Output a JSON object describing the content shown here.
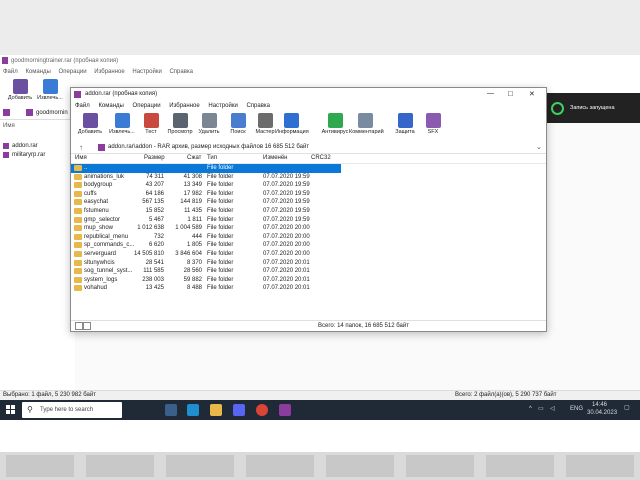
{
  "background_window": {
    "title": "goodmorningtrainer.rar (пробная копия)",
    "menu": [
      "Файл",
      "Команды",
      "Операции",
      "Избранное",
      "Настройки",
      "Справка"
    ],
    "tools": [
      "Добавить",
      "Извлечь..."
    ],
    "addr": "goodmornin",
    "list_header": "Имя",
    "files": [
      "addon.rar",
      "militaryrp.rar"
    ],
    "status_left": "Выбрано: 1 файл, 5 230 982 байт",
    "status_right": "Всего: 2 файл(а)(ов), 5 290 737 байт"
  },
  "notification": {
    "text": "Запись запущена"
  },
  "window": {
    "title": "addon.rar (пробная копия)",
    "controls": [
      "—",
      "□",
      "✕"
    ],
    "menu": [
      "Файл",
      "Команды",
      "Операции",
      "Избранное",
      "Настройки",
      "Справка"
    ],
    "tools": [
      {
        "label": "Добавить",
        "icon": "add-archive-icon",
        "color": "#6b4fa0"
      },
      {
        "label": "Извлечь...",
        "icon": "extract-icon",
        "color": "#3a7bd5"
      },
      {
        "label": "Тест",
        "icon": "test-icon",
        "color": "#c94a3c"
      },
      {
        "label": "Просмотр",
        "icon": "view-icon",
        "color": "#5a6470"
      },
      {
        "label": "Удалить",
        "icon": "delete-icon",
        "color": "#7a8694"
      },
      {
        "label": "Поиск",
        "icon": "find-icon",
        "color": "#4a7ccf"
      },
      {
        "label": "Мастер",
        "icon": "wizard-icon",
        "color": "#6c6c6c"
      },
      {
        "label": "Информация",
        "icon": "info-icon",
        "color": "#2f6fd1"
      },
      {
        "label": "Антивирус",
        "icon": "antivirus-icon",
        "color": "#2fa84f"
      },
      {
        "label": "Комментарий",
        "icon": "comment-icon",
        "color": "#7a8aa0"
      },
      {
        "label": "Защита",
        "icon": "protect-icon",
        "color": "#3566c9"
      },
      {
        "label": "SFX",
        "icon": "sfx-icon",
        "color": "#8a5ab0"
      }
    ],
    "address": "addon.rar\\addon - RAR архив, размер исходных файлов 16 685 512 байт",
    "columns": [
      "Имя",
      "Размер",
      "Сжат",
      "Тип",
      "Изменён",
      "CRC32"
    ],
    "rows": [
      {
        "name": "..",
        "size": "",
        "packed": "",
        "type": "File folder",
        "modified": "",
        "selected": true
      },
      {
        "name": "animations_luk",
        "size": "74 311",
        "packed": "41 308",
        "type": "File folder",
        "modified": "07.07.2020 19:59",
        "selected": false
      },
      {
        "name": "bodygroup",
        "size": "43 207",
        "packed": "13 349",
        "type": "File folder",
        "modified": "07.07.2020 19:59",
        "selected": false
      },
      {
        "name": "cuffs",
        "size": "64 186",
        "packed": "17 982",
        "type": "File folder",
        "modified": "07.07.2020 19:59",
        "selected": false
      },
      {
        "name": "easychat",
        "size": "567 135",
        "packed": "144 819",
        "type": "File folder",
        "modified": "07.07.2020 19:59",
        "selected": false
      },
      {
        "name": "fstumenu",
        "size": "15 852",
        "packed": "11 435",
        "type": "File folder",
        "modified": "07.07.2020 19:59",
        "selected": false
      },
      {
        "name": "gmp_selector",
        "size": "5 467",
        "packed": "1 811",
        "type": "File folder",
        "modified": "07.07.2020 19:59",
        "selected": false
      },
      {
        "name": "mup_show",
        "size": "1 012 638",
        "packed": "1 004 589",
        "type": "File folder",
        "modified": "07.07.2020 20:00",
        "selected": false
      },
      {
        "name": "republical_menu",
        "size": "732",
        "packed": "444",
        "type": "File folder",
        "modified": "07.07.2020 20:00",
        "selected": false
      },
      {
        "name": "sp_commands_c...",
        "size": "6 620",
        "packed": "1 805",
        "type": "File folder",
        "modified": "07.07.2020 20:00",
        "selected": false
      },
      {
        "name": "serverguard",
        "size": "14 505 810",
        "packed": "3 846 604",
        "type": "File folder",
        "modified": "07.07.2020 20:00",
        "selected": false
      },
      {
        "name": "sltunywhcis",
        "size": "28 541",
        "packed": "8 370",
        "type": "File folder",
        "modified": "07.07.2020 20:01",
        "selected": false
      },
      {
        "name": "sog_tunnel_syst...",
        "size": "111 585",
        "packed": "28 560",
        "type": "File folder",
        "modified": "07.07.2020 20:01",
        "selected": false
      },
      {
        "name": "system_logs",
        "size": "238 003",
        "packed": "59 882",
        "type": "File folder",
        "modified": "07.07.2020 20:01",
        "selected": false
      },
      {
        "name": "vohahud",
        "size": "13 425",
        "packed": "8 488",
        "type": "File folder",
        "modified": "07.07.2020 20:01",
        "selected": false
      }
    ],
    "status": "Всего: 14 папок, 16 685 512 байт"
  },
  "taskbar": {
    "search_placeholder": "Type here to search",
    "lang": "ENG",
    "time": "14:46",
    "date": "30.04.2023"
  }
}
